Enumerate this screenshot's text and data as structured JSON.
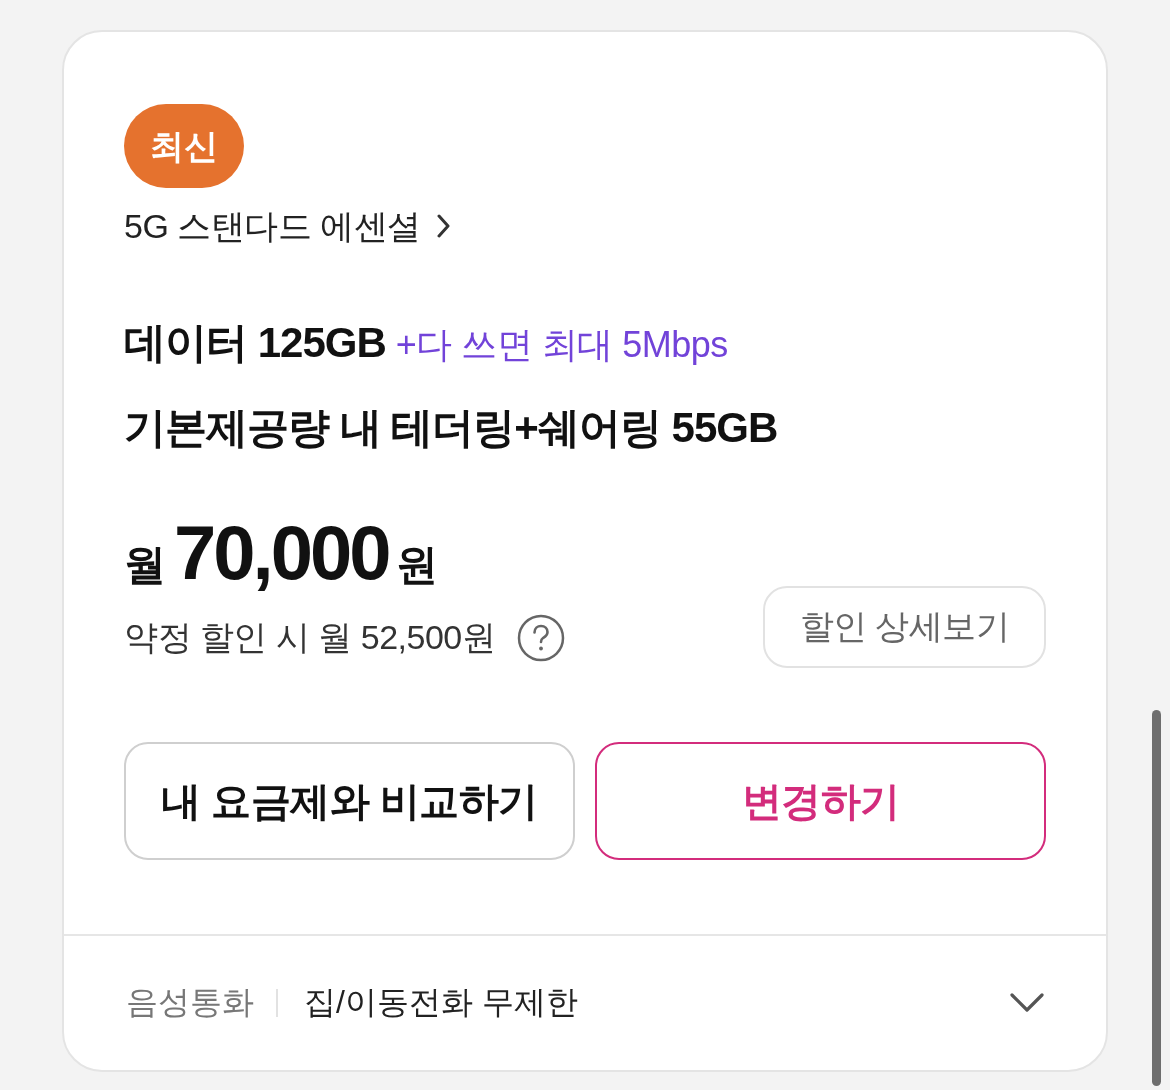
{
  "badge": {
    "label": "최신"
  },
  "plan": {
    "name": "5G 스탠다드 에센셜"
  },
  "data": {
    "amount": "데이터 125GB",
    "note": "+다 쓰면 최대 5Mbps"
  },
  "sharing": "기본제공량 내 테더링+쉐어링 55GB",
  "price": {
    "prefix": "월",
    "amount": "70,000",
    "unit": "원"
  },
  "discount": {
    "text": "약정 할인 시 월 52,500원",
    "details_button": "할인 상세보기"
  },
  "buttons": [
    {
      "label": "내 요금제와 비교하기",
      "kind": "secondary"
    },
    {
      "label": "변경하기",
      "kind": "primary"
    }
  ],
  "voice": {
    "label": "음성통화",
    "value": "집/이동전화 무제한",
    "expanded": false
  }
}
